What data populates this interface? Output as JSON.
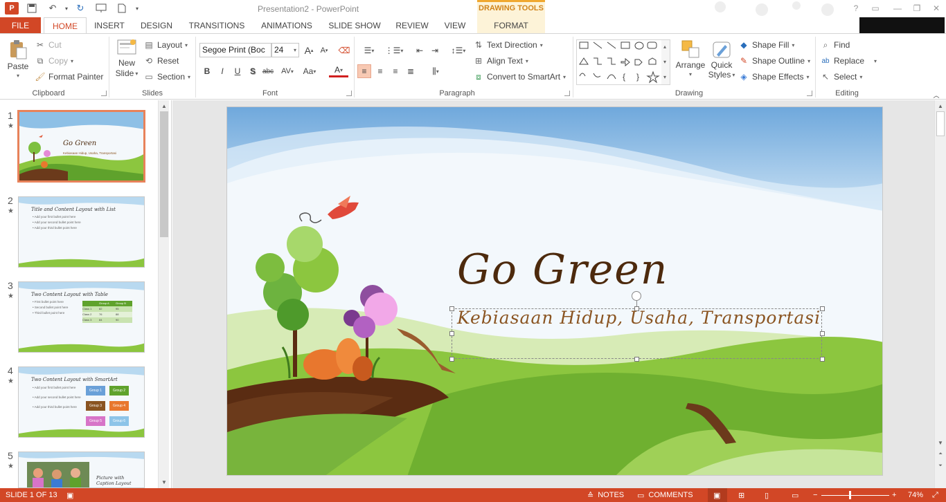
{
  "window": {
    "title": "Presentation2 - PowerPoint",
    "context_tab_group": "DRAWING TOOLS",
    "app_icon": "P"
  },
  "tabs": [
    "FILE",
    "HOME",
    "INSERT",
    "DESIGN",
    "TRANSITIONS",
    "ANIMATIONS",
    "SLIDE SHOW",
    "REVIEW",
    "VIEW",
    "FORMAT"
  ],
  "active_tab": "HOME",
  "ribbon": {
    "clipboard": {
      "label": "Clipboard",
      "paste": "Paste",
      "cut": "Cut",
      "copy": "Copy",
      "format_painter": "Format Painter"
    },
    "slides": {
      "label": "Slides",
      "new_slide_1": "New",
      "new_slide_2": "Slide",
      "layout": "Layout",
      "reset": "Reset",
      "section": "Section"
    },
    "font": {
      "label": "Font",
      "font_name": "Segoe Print (Boc",
      "font_size": "24",
      "bold": "B",
      "italic": "I",
      "underline": "U",
      "shadow": "S",
      "strike": "abc",
      "spacing": "AV",
      "case": "Aa",
      "color": "A",
      "grow": "A",
      "shrink": "A"
    },
    "paragraph": {
      "label": "Paragraph",
      "text_direction": "Text Direction",
      "align_text": "Align Text",
      "convert_smartart": "Convert to SmartArt"
    },
    "drawing": {
      "label": "Drawing",
      "arrange": "Arrange",
      "quick_1": "Quick",
      "quick_2": "Styles",
      "shape_fill": "Shape Fill",
      "shape_outline": "Shape Outline",
      "shape_effects": "Shape Effects"
    },
    "editing": {
      "label": "Editing",
      "find": "Find",
      "replace": "Replace",
      "select": "Select"
    }
  },
  "thumbnails": [
    {
      "num": "1",
      "title": "Go Green",
      "subtitle": "Kebiasaan Hidup, Usaha, Transportasi"
    },
    {
      "num": "2",
      "title": "Title and Content Layout with List",
      "bullets": [
        "Add your first bullet point here",
        "Add your second bullet point here",
        "Add your third bullet point here"
      ]
    },
    {
      "num": "3",
      "title": "Two Content Layout with Table",
      "bullets": [
        "First bullet point here",
        "Second bullet point here",
        "Third bullet point here"
      ],
      "table_head": [
        "",
        "Group A",
        "Group B"
      ],
      "table_rows": [
        [
          "Class 1",
          "82",
          "95"
        ],
        [
          "Class 2",
          "76",
          "88"
        ],
        [
          "Class 3",
          "84",
          "90"
        ]
      ]
    },
    {
      "num": "4",
      "title": "Two Content Layout with SmartArt",
      "bullets": [
        "Add your first bullet point here",
        "Add your second bullet point here",
        "Add your third bullet point here"
      ],
      "groups": [
        "Group 1",
        "Group 2",
        "Group 3",
        "Group 4",
        "Group 5",
        "Group 6"
      ]
    },
    {
      "num": "5",
      "title_1": "Picture with",
      "title_2": "Caption Layout"
    }
  ],
  "slide": {
    "title": "Go Green",
    "subtitle": "Kebiasaan Hidup, Usaha, Transportasi"
  },
  "status": {
    "slide_info": "SLIDE 1 OF 13",
    "notes": "NOTES",
    "comments": "COMMENTS",
    "zoom": "74%",
    "zoom_fraction": 0.42
  },
  "colors": {
    "accent": "#d24726",
    "context": "#d0841b"
  }
}
